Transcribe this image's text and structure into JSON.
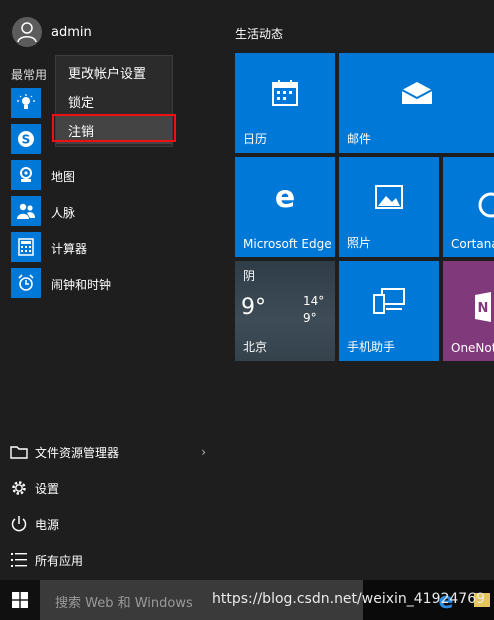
{
  "user": {
    "name": "admin"
  },
  "app_list": {
    "section_label": "最常用",
    "items": [
      {
        "label": "",
        "icon": "lightbulb-icon"
      },
      {
        "label": "",
        "icon": "skype-icon"
      },
      {
        "label": "地图",
        "icon": "map-icon"
      },
      {
        "label": "人脉",
        "icon": "people-icon"
      },
      {
        "label": "计算器",
        "icon": "calculator-icon"
      },
      {
        "label": "闹钟和时钟",
        "icon": "alarm-clock-icon"
      }
    ]
  },
  "context_menu": {
    "items": [
      "更改帐户设置",
      "锁定",
      "注销"
    ],
    "highlighted": "注销"
  },
  "system_links": {
    "file_explorer": "文件资源管理器",
    "settings": "设置",
    "power": "电源",
    "all_apps": "所有应用"
  },
  "tiles": {
    "group_title": "生活动态",
    "calendar": "日历",
    "mail": "邮件",
    "edge": "Microsoft Edge",
    "photos": "照片",
    "cortana": "Cortana",
    "phone": "手机助手",
    "onenote": "OneNot",
    "weather": {
      "condition": "阴",
      "temp": "9°",
      "high": "14°",
      "low": "9°",
      "city": "北京"
    }
  },
  "taskbar": {
    "search_placeholder": "搜索 Web 和 Windows",
    "watermark": "https://blog.csdn.net/weixin_41924769"
  },
  "colors": {
    "accent": "#0078d7",
    "onenote": "#80397b",
    "highlight_border": "#e11111"
  }
}
